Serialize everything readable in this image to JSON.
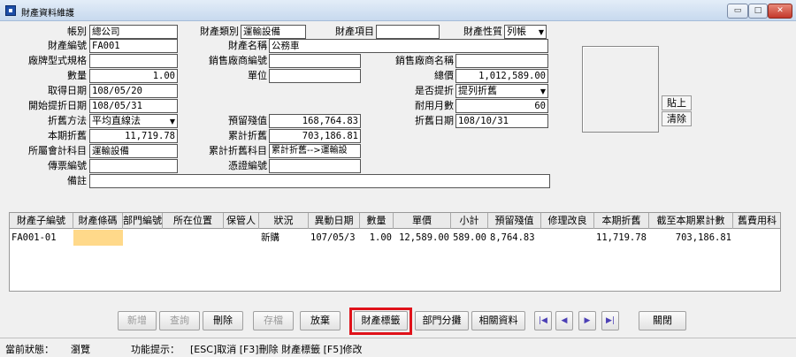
{
  "window": {
    "title": "財產資料維護",
    "controls": {
      "minimize": "▭",
      "maximize": "□",
      "close": "✕"
    }
  },
  "form": {
    "account_label": "帳別",
    "account_value": "總公司",
    "category_label": "財產類別",
    "category_value": "運輸設備",
    "item_label": "財產項目",
    "item_value": "",
    "nature_label": "財產性質",
    "nature_value": "列帳",
    "asset_no_label": "財產編號",
    "asset_no_value": "FA001",
    "asset_name_label": "財產名稱",
    "asset_name_value": "公務車",
    "brand_label": "廠牌型式規格",
    "brand_value": "",
    "vendor_no_label": "銷售廠商編號",
    "vendor_no_value": "",
    "vendor_name_label": "銷售廠商名稱",
    "vendor_name_value": "",
    "qty_label": "數量",
    "qty_value": "1.00",
    "unit_label": "單位",
    "unit_value": "",
    "total_price_label": "總價",
    "total_price_value": "1,012,589.00",
    "acq_date_label": "取得日期",
    "acq_date_value": "108/05/20",
    "depr_flag_label": "是否提折",
    "depr_flag_value": "提列折舊",
    "depr_start_label": "開始提折日期",
    "depr_start_value": "108/05/31",
    "useful_months_label": "耐用月數",
    "useful_months_value": "60",
    "depr_method_label": "折舊方法",
    "depr_method_value": "平均直線法",
    "residual_label": "預留殘值",
    "residual_value": "168,764.83",
    "depr_date_label": "折舊日期",
    "depr_date_value": "108/10/31",
    "period_depr_label": "本期折舊",
    "period_depr_value": "11,719.78",
    "accum_depr_label": "累計折舊",
    "accum_depr_value": "703,186.81",
    "acct_subject_label": "所屬會計科目",
    "acct_subject_value": "運輸設備",
    "accum_subject_label": "累計折舊科目",
    "accum_subject_value": "累計折舊-->運輸設",
    "voucher_label": "傳票編號",
    "voucher_value": "",
    "cert_label": "憑證編號",
    "cert_value": "",
    "note_label": "備註",
    "note_value": ""
  },
  "photo": {
    "paste_label": "貼上",
    "clear_label": "清除"
  },
  "table": {
    "headers": [
      "財產子編號",
      "財產條碼",
      "部門編號",
      "所在位置",
      "保管人",
      "狀況",
      "異動日期",
      "數量",
      "單價",
      "小計",
      "預留殘值",
      "修理改良",
      "本期折舊",
      "截至本期累計數",
      "舊費用科"
    ],
    "rows": [
      [
        "FA001-01",
        "",
        "",
        "",
        "",
        "新購",
        "107/05/3",
        "1.00",
        "12,589.00",
        "589.00",
        "8,764.83",
        "",
        "11,719.78",
        "703,186.81",
        ""
      ]
    ]
  },
  "buttons": {
    "new": "新增",
    "query": "查詢",
    "delete": "刪除",
    "save": "存檔",
    "discard": "放棄",
    "label": "財產標籤",
    "split": "部門分攤",
    "related": "相關資料",
    "first": "|◀",
    "prev": "◀",
    "next": "▶",
    "last": "▶|",
    "close": "關閉"
  },
  "status": {
    "state_label": "當前狀態：",
    "state_value": "瀏覽",
    "hint_label": "功能提示：",
    "hint_value": "[ESC]取消 [F3]刪除 財產標籤 [F5]修改"
  },
  "colors": {
    "highlight_border": "#e0121a",
    "barcode_cell": "#ffd98a",
    "nav_arrow": "#4b3fb5"
  }
}
